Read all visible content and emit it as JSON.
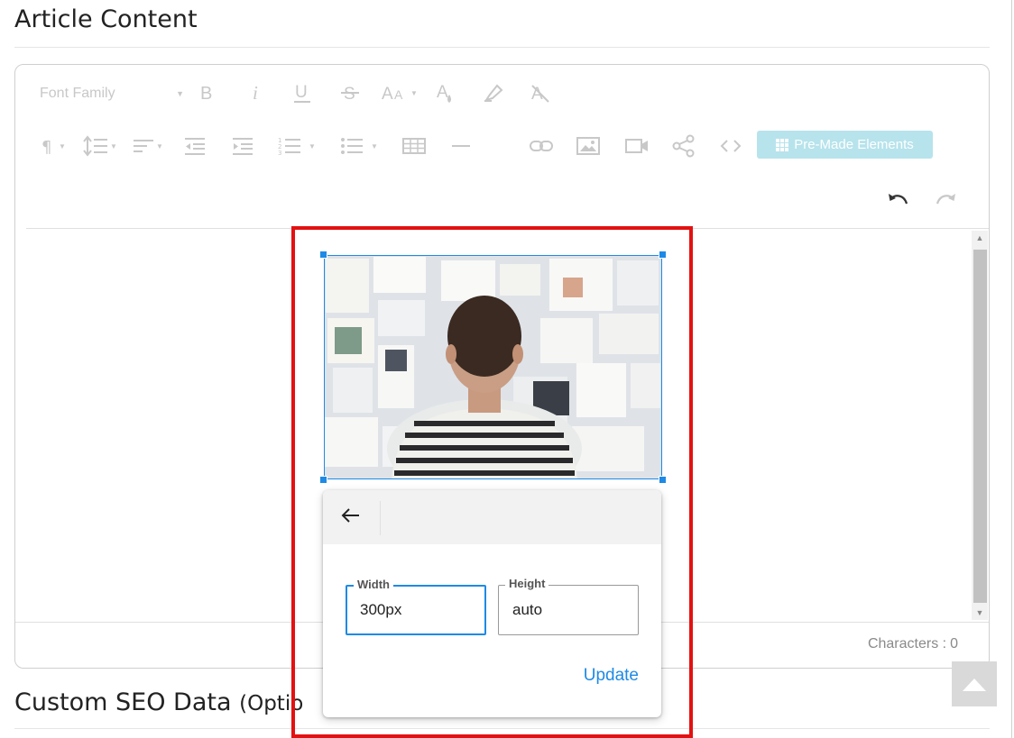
{
  "page": {
    "article_heading": "Article Content",
    "seo_heading": "Custom SEO Data",
    "seo_heading_suffix": "(Optio"
  },
  "toolbar": {
    "font_family_label": "Font Family",
    "row1_icons": [
      "bold-icon",
      "italic-icon",
      "underline-icon",
      "strikethrough-icon",
      "font-size-icon",
      "text-color-icon",
      "highlight-icon",
      "clear-format-icon"
    ],
    "row2_icons": [
      "paragraph-format-icon",
      "line-height-icon",
      "align-icon",
      "outdent-icon",
      "indent-icon",
      "ordered-list-icon",
      "unordered-list-icon",
      "table-icon",
      "horizontal-line-icon",
      "link-icon",
      "image-icon",
      "video-icon",
      "share-icon",
      "code-view-icon"
    ],
    "premade_label": "Pre-Made Elements",
    "premade_color": "#b7e3ec"
  },
  "editor": {
    "char_count_label": "Characters :",
    "char_count_value": "0"
  },
  "image_popup": {
    "back_icon": "arrow-left-icon",
    "width_label": "Width",
    "width_value": "300px",
    "height_label": "Height",
    "height_value": "auto",
    "update_label": "Update",
    "accent_color": "#1e8ae6"
  },
  "highlight_color": "#e31111"
}
